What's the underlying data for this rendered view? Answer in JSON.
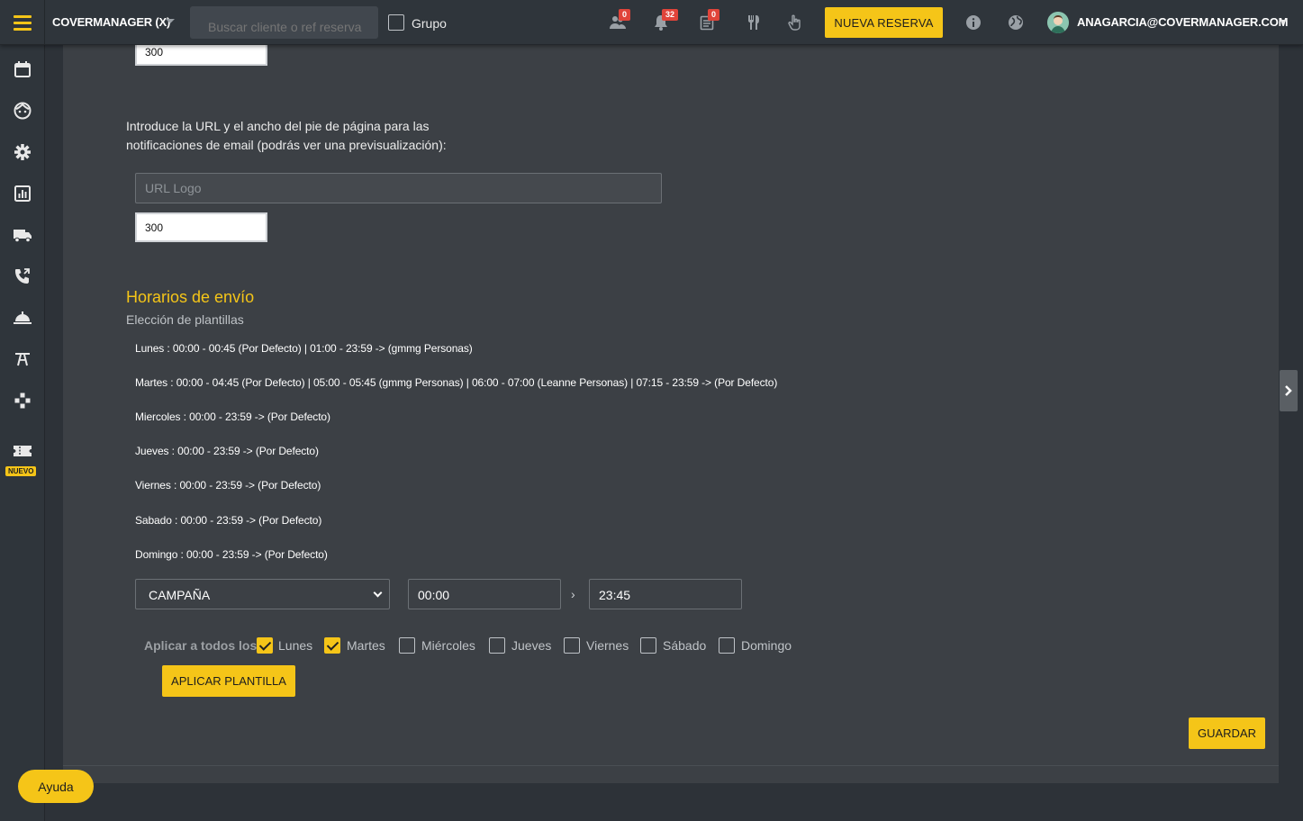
{
  "topbar": {
    "brand": "COVERMANAGER (X)",
    "search_placeholder": "Buscar cliente o ref reserva",
    "grupo_label": "Grupo",
    "badges": {
      "people": "0",
      "bell": "32",
      "clipboard": "0"
    },
    "new_reservation": "NUEVA RESERVA",
    "user_email": "ANAGARCIA@COVERMANAGER.COM"
  },
  "sidebar": {
    "icons": [
      "calendar-icon",
      "face-icon",
      "gear-icon",
      "chart-icon",
      "truck-icon",
      "phone-icon",
      "cloche-icon",
      "table-icon",
      "gamepad-icon",
      "ticket-icon"
    ],
    "new_badge": "NUEVO"
  },
  "footer_settings": {
    "top_width_value": "300",
    "intro_text": "Introduce la URL y el ancho del pie de página para las notificaciones de email (podrás ver una previsualización):",
    "url_placeholder": "URL Logo",
    "width_value": "300"
  },
  "schedule": {
    "title": "Horarios de envío",
    "subtitle": "Elección de plantillas",
    "lines": [
      "Lunes : 00:00 - 00:45 (Por Defecto) | 01:00 - 23:59 -> (gmmg Personas)",
      "Martes : 00:00 - 04:45 (Por Defecto) | 05:00 - 05:45 (gmmg Personas) | 06:00 - 07:00 (Leanne Personas) | 07:15 - 23:59 -> (Por Defecto)",
      "Miercoles : 00:00 - 23:59 -> (Por Defecto)",
      "Jueves : 00:00 - 23:59 -> (Por Defecto)",
      "Viernes : 00:00 - 23:59 -> (Por Defecto)",
      "Sabado : 00:00 - 23:59 -> (Por Defecto)",
      "Domingo : 00:00 - 23:59 -> (Por Defecto)"
    ],
    "template_select": "CAMPAÑA",
    "time_from": "00:00",
    "time_separator": "›",
    "time_to": "23:45",
    "apply_label": "Aplicar a todos los:",
    "days": [
      {
        "label": "Lunes",
        "checked": true
      },
      {
        "label": "Martes",
        "checked": true
      },
      {
        "label": "Miércoles",
        "checked": false
      },
      {
        "label": "Jueves",
        "checked": false
      },
      {
        "label": "Viernes",
        "checked": false
      },
      {
        "label": "Sábado",
        "checked": false
      },
      {
        "label": "Domingo",
        "checked": false
      }
    ],
    "apply_button": "APLICAR PLANTILLA",
    "save_button": "GUARDAR"
  },
  "help_button": "Ayuda",
  "colors": {
    "accent": "#f5c518",
    "badge": "#e0443a",
    "panel": "#3c4045",
    "background": "#2d3238"
  }
}
